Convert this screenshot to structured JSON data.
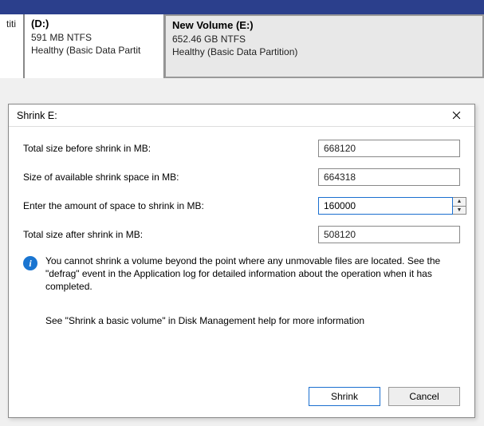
{
  "partitions": {
    "frag": {
      "label": "titi"
    },
    "d": {
      "title": "(D:)",
      "size": "591 MB NTFS",
      "status": "Healthy (Basic Data Partit"
    },
    "e": {
      "title": "New Volume  (E:)",
      "size": "652.46 GB NTFS",
      "status": "Healthy (Basic Data Partition)"
    }
  },
  "dialog": {
    "title": "Shrink E:",
    "rows": {
      "total_before": {
        "label": "Total size before shrink in MB:",
        "value": "668120"
      },
      "available": {
        "label": "Size of available shrink space in MB:",
        "value": "664318"
      },
      "amount": {
        "label": "Enter the amount of space to shrink in MB:",
        "value": "160000"
      },
      "total_after": {
        "label": "Total size after shrink in MB:",
        "value": "508120"
      }
    },
    "info_line1": "You cannot shrink a volume beyond the point where any unmovable files are located. See the \"defrag\" event in the Application log for detailed information about the operation when it has completed.",
    "info_line2": "See \"Shrink a basic volume\" in Disk Management help for more information",
    "buttons": {
      "shrink": "Shrink",
      "cancel": "Cancel"
    }
  }
}
